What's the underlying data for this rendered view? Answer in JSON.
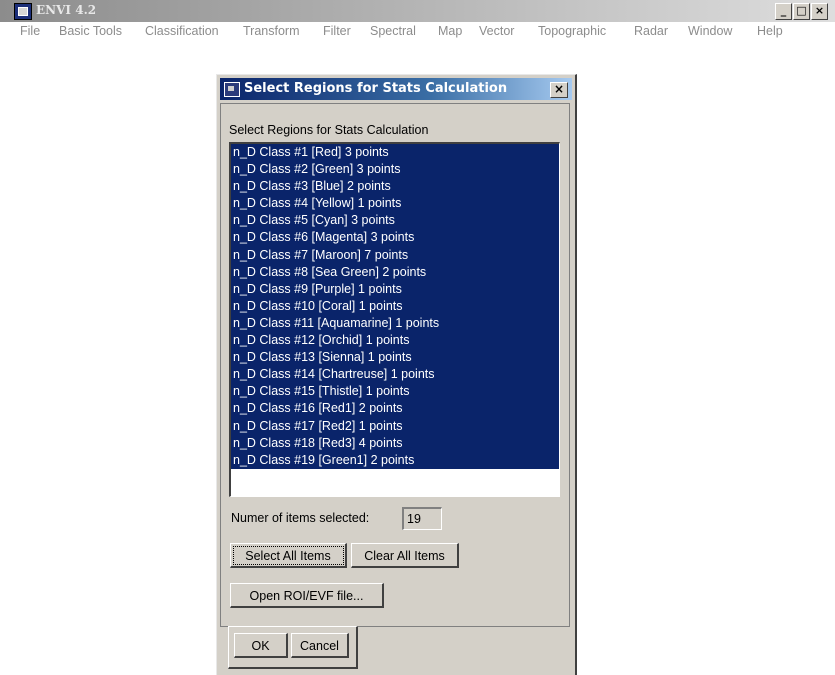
{
  "app": {
    "title": "ENVI 4.2",
    "window_controls": {
      "minimize": "_",
      "maximize": "□",
      "close": "×"
    }
  },
  "menubar": {
    "items": [
      "File",
      "Basic Tools",
      "Classification",
      "Transform",
      "Filter",
      "Spectral",
      "Map",
      "Vector",
      "Topographic",
      "Radar",
      "Window",
      "Help"
    ]
  },
  "dialog": {
    "title": "Select Regions for Stats Calculation",
    "close_label": "×",
    "label": "Select Regions for Stats Calculation",
    "roi_items": [
      "n_D Class #1 [Red] 3 points",
      "n_D Class #2 [Green] 3 points",
      "n_D Class #3 [Blue] 2 points",
      "n_D Class #4 [Yellow] 1 points",
      "n_D Class #5 [Cyan] 3 points",
      "n_D Class #6 [Magenta] 3 points",
      "n_D Class #7 [Maroon] 7 points",
      "n_D Class #8 [Sea Green] 2 points",
      "n_D Class #9 [Purple] 1 points",
      "n_D Class #10 [Coral] 1 points",
      "n_D Class #11 [Aquamarine] 1 points",
      "n_D Class #12 [Orchid] 1 points",
      "n_D Class #13 [Sienna] 1 points",
      "n_D Class #14 [Chartreuse] 1 points",
      "n_D Class #15 [Thistle] 1 points",
      "n_D Class #16 [Red1] 2 points",
      "n_D Class #17 [Red2] 1 points",
      "n_D Class #18 [Red3] 4 points",
      "n_D Class #19 [Green1] 2 points"
    ],
    "count_label": "Numer of items selected:",
    "count_value": "19",
    "buttons": {
      "select_all": "Select All Items",
      "clear_all": "Clear All Items",
      "open_file": "Open ROI/EVF file...",
      "ok": "OK",
      "cancel": "Cancel"
    }
  },
  "colors": {
    "selection": "#0a246a",
    "dialog_bg": "#d4d0c8",
    "menu_text": "#8c8c8c"
  }
}
